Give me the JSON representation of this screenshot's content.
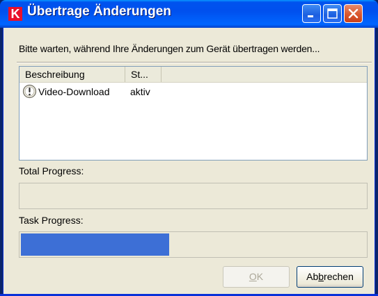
{
  "window": {
    "title": "Übertrage Änderungen",
    "icon_letter": "K",
    "icon": "app-k-icon",
    "colors": {
      "titlebar": "#0050ee",
      "client_bg": "#ece9d8",
      "progress_fill": "#3d6fd6"
    }
  },
  "status_text": "Bitte warten, während Ihre Änderungen zum Gerät übertragen werden...",
  "list": {
    "columns": [
      "Beschreibung",
      "St..."
    ],
    "rows": [
      {
        "icon": "info-exclamation-icon",
        "description": "Video-Download",
        "status": "aktiv"
      }
    ]
  },
  "total_progress": {
    "label": "Total Progress:",
    "value": 0
  },
  "task_progress": {
    "label": "Task Progress:",
    "value": 0.43
  },
  "buttons": {
    "ok": {
      "label_mnemonic": "O",
      "label_rest": "K",
      "enabled": false
    },
    "cancel": {
      "label_pre": "Ab",
      "label_mnemonic": "b",
      "label_rest": "rechen"
    }
  }
}
